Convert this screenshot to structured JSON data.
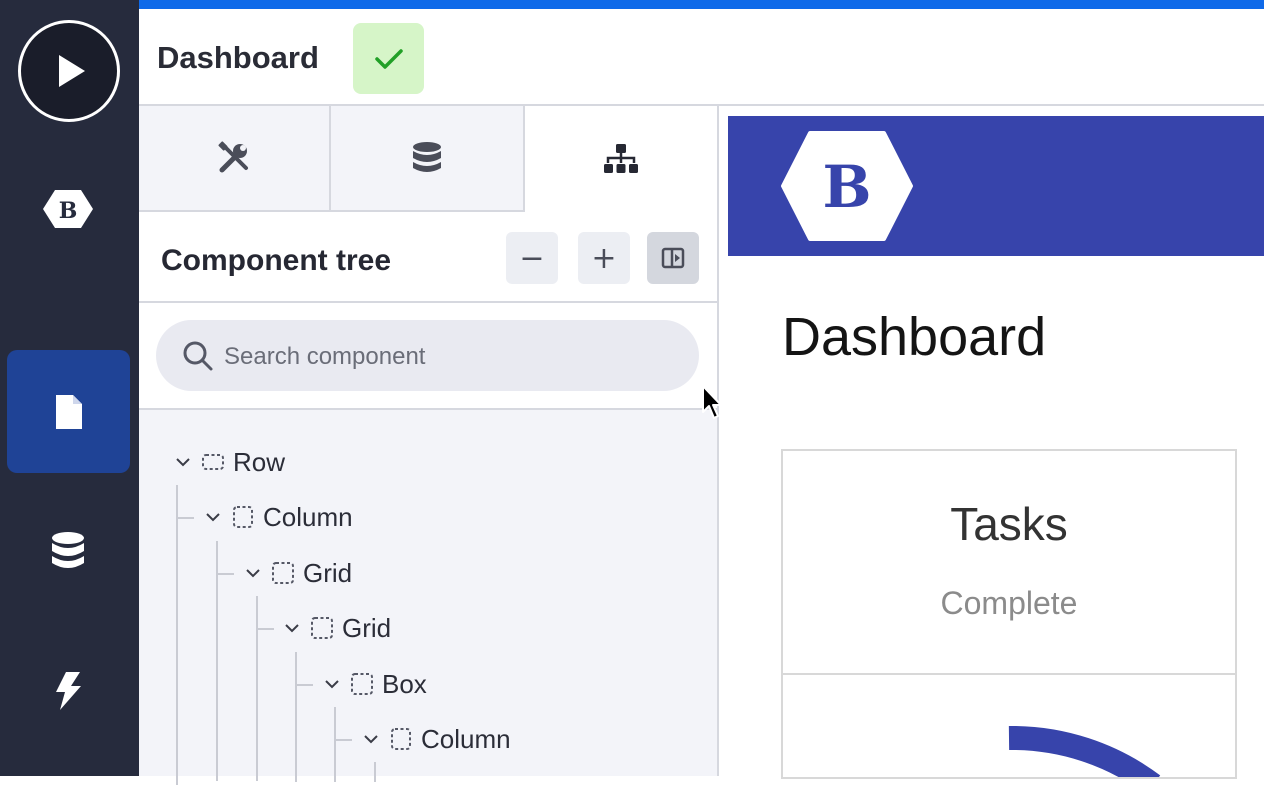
{
  "app": {
    "page_title": "Dashboard"
  },
  "colors": {
    "sidebar_bg": "#262b3d",
    "sidebar_active": "#1f4396",
    "top_stripe": "#0f6ae9",
    "status_ok_bg": "#d6f5c8",
    "status_ok_check": "#22a027",
    "app_header": "#3744ab"
  },
  "sidebar": {
    "items": [
      {
        "name": "play",
        "icon": "play-icon"
      },
      {
        "name": "budibase",
        "icon": "budibase-logo-icon"
      },
      {
        "name": "pages",
        "icon": "file-icon",
        "active": true
      },
      {
        "name": "data",
        "icon": "database-icon"
      },
      {
        "name": "automation",
        "icon": "lightning-icon"
      }
    ]
  },
  "topbar": {
    "title": "Dashboard",
    "status_icon": "check-icon"
  },
  "panel": {
    "tabs": [
      {
        "icon": "tools-icon"
      },
      {
        "icon": "database-icon"
      },
      {
        "icon": "sitemap-icon",
        "active": true
      }
    ],
    "header": {
      "title": "Component tree",
      "collapse_label": "−",
      "expand_label": "+",
      "toggle_icon": "panel-toggle-icon"
    },
    "search": {
      "placeholder": "Search component",
      "value": ""
    },
    "tree": [
      {
        "label": "Row",
        "depth": 0
      },
      {
        "label": "Column",
        "depth": 1
      },
      {
        "label": "Grid",
        "depth": 2
      },
      {
        "label": "Grid",
        "depth": 3
      },
      {
        "label": "Box",
        "depth": 4
      },
      {
        "label": "Column",
        "depth": 5
      }
    ]
  },
  "preview": {
    "logo_letter": "B",
    "title": "Dashboard",
    "card": {
      "title": "Tasks",
      "subtitle": "Complete"
    }
  }
}
